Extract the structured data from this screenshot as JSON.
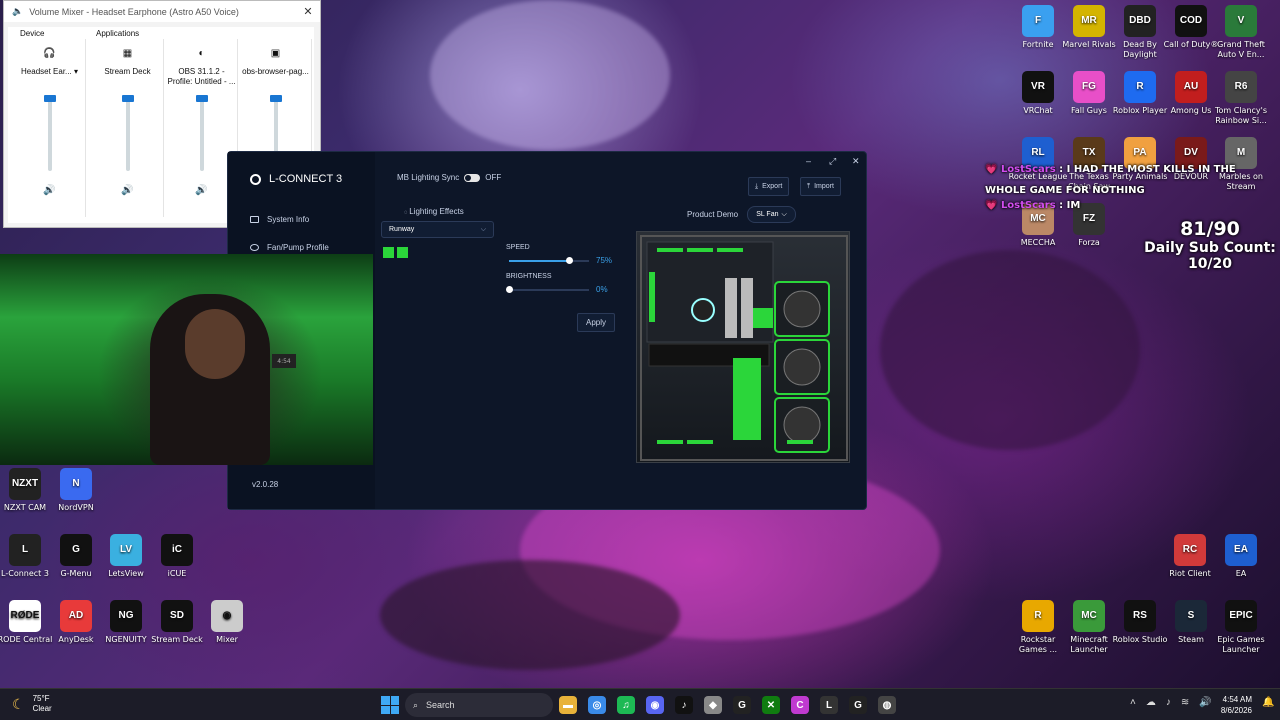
{
  "mixer": {
    "title": "Volume Mixer - Headset Earphone (Astro A50 Voice)",
    "close": "✕",
    "device_label": "Device",
    "applications_label": "Applications",
    "columns": [
      {
        "name": "Headset Ear... ▾",
        "icon": "headset-icon",
        "level": 1.0
      },
      {
        "name": "Stream Deck",
        "icon": "stream-deck-icon",
        "level": 1.0
      },
      {
        "name": "OBS 31.1.2 - Profile: Untitled - ...",
        "icon": "obs-icon",
        "level": 1.0
      },
      {
        "name": "obs-browser-pag...",
        "icon": "window-icon",
        "level": 1.0
      }
    ]
  },
  "lconnect": {
    "brand": "L-CONNECT 3",
    "nav": [
      "System Info",
      "Fan/Pump Profile"
    ],
    "version": "v2.0.28",
    "window_controls": [
      "–",
      "⤢",
      "✕"
    ],
    "mb_sync_label": "MB Lighting Sync",
    "mb_sync_state": "OFF",
    "export": "Export",
    "import": "Import",
    "lighting_effects_label": "Lighting Effects",
    "effect": "Runway",
    "speed_label": "SPEED",
    "speed_value": "75%",
    "speed": 0.75,
    "brightness_label": "BRIGHTNESS",
    "brightness_value": "0%",
    "brightness": 0.0,
    "apply": "Apply",
    "product_demo_label": "Product Demo",
    "product_demo_value": "SL Fan",
    "accent": "#3aa0e8",
    "swatch_color": "#2bd63a"
  },
  "webcam": {
    "timer": "4:54"
  },
  "overlay": {
    "chat": [
      {
        "user": "LostScars",
        "sep": ":",
        "msg": "I HAD THE MOST KILLS IN THE WHOLE GAME FOR NOTHING"
      },
      {
        "user": "LostScars",
        "sep": ":",
        "msg": "IM"
      }
    ],
    "sub_progress": "81/90",
    "sub_label": "Daily Sub Count:",
    "sub_value": "10/20"
  },
  "desktop_icons_right": [
    {
      "label": "Fortnite",
      "abbr": "F",
      "color": "#3aa0f0"
    },
    {
      "label": "Marvel Rivals",
      "abbr": "MR",
      "color": "#d4b400"
    },
    {
      "label": "Dead By Daylight",
      "abbr": "DBD",
      "color": "#222"
    },
    {
      "label": "Call of Duty®",
      "abbr": "COD",
      "color": "#111"
    },
    {
      "label": "Grand Theft Auto V En...",
      "abbr": "V",
      "color": "#2a7a3a"
    },
    {
      "label": "VRChat",
      "abbr": "VR",
      "color": "#111"
    },
    {
      "label": "Fall Guys",
      "abbr": "FG",
      "color": "#e84fc8"
    },
    {
      "label": "Roblox Player",
      "abbr": "R",
      "color": "#1e6bf0"
    },
    {
      "label": "Among Us",
      "abbr": "AU",
      "color": "#c21e1e"
    },
    {
      "label": "Tom Clancy's Rainbow Si...",
      "abbr": "R6",
      "color": "#444"
    },
    {
      "label": "Rocket League",
      "abbr": "RL",
      "color": "#1e5fd0"
    },
    {
      "label": "The Texas Chain Saw",
      "abbr": "TX",
      "color": "#5a3a1a"
    },
    {
      "label": "Party Animals",
      "abbr": "PA",
      "color": "#f0a040"
    },
    {
      "label": "DEVOUR",
      "abbr": "DV",
      "color": "#7a1a1a"
    },
    {
      "label": "Marbles on Stream",
      "abbr": "M",
      "color": "#666"
    },
    {
      "label": "MECCHA",
      "abbr": "MC",
      "color": "#bb8866"
    },
    {
      "label": "Forza",
      "abbr": "FZ",
      "color": "#333"
    }
  ],
  "desktop_icons_left": [
    {
      "label": "NZXT CAM",
      "abbr": "NZXT",
      "color": "#222"
    },
    {
      "label": "NordVPN",
      "abbr": "N",
      "color": "#3a6af0"
    },
    {
      "label": "L-Connect 3",
      "abbr": "L",
      "color": "#222"
    },
    {
      "label": "G-Menu",
      "abbr": "G",
      "color": "#111"
    },
    {
      "label": "LetsView",
      "abbr": "LV",
      "color": "#3ab0e0"
    },
    {
      "label": "iCUE",
      "abbr": "iC",
      "color": "#111"
    },
    {
      "label": "RODE Central",
      "abbr": "RØDE",
      "color": "#fff"
    },
    {
      "label": "AnyDesk",
      "abbr": "AD",
      "color": "#e83a3a"
    },
    {
      "label": "NGENUITY",
      "abbr": "NG",
      "color": "#111"
    },
    {
      "label": "Stream Deck",
      "abbr": "SD",
      "color": "#111"
    },
    {
      "label": "Mixer",
      "abbr": "◉",
      "color": "#ccc"
    }
  ],
  "desktop_icons_bottom_right": [
    {
      "label": "Riot Client",
      "abbr": "RC",
      "color": "#d13a3a"
    },
    {
      "label": "EA",
      "abbr": "EA",
      "color": "#1e5fd0"
    },
    {
      "label": "Rockstar Games ...",
      "abbr": "R",
      "color": "#e8a800"
    },
    {
      "label": "Minecraft Launcher",
      "abbr": "MC",
      "color": "#3a9a3a"
    },
    {
      "label": "Roblox Studio",
      "abbr": "RS",
      "color": "#111"
    },
    {
      "label": "Steam",
      "abbr": "S",
      "color": "#1b2838"
    },
    {
      "label": "Epic Games Launcher",
      "abbr": "EPIC",
      "color": "#111"
    }
  ],
  "taskbar": {
    "weather_temp": "75°F",
    "weather_cond": "Clear",
    "search_placeholder": "Search",
    "time": "4:54 AM",
    "date": "8/6/2026",
    "apps": [
      "Explorer",
      "Chrome",
      "Spotify",
      "Discord",
      "TikTok",
      "Shield",
      "G",
      "Xbox",
      "C",
      "L",
      "G2",
      "OBS"
    ]
  }
}
